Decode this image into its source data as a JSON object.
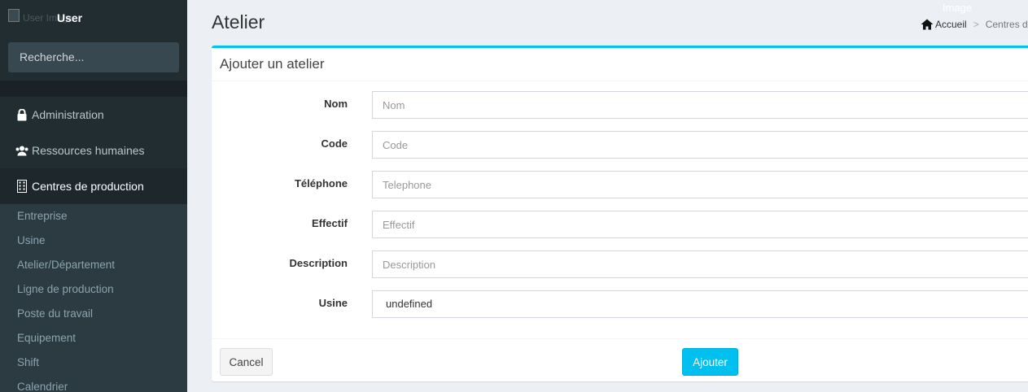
{
  "sidebar": {
    "user_img_alt": "User Image",
    "user_name": "User",
    "search_placeholder": "Recherche...",
    "menu": [
      {
        "label": "Administration",
        "icon": "lock-icon"
      },
      {
        "label": "Ressources humaines",
        "icon": "users-icon"
      },
      {
        "label": "Centres de production",
        "icon": "building-icon"
      }
    ],
    "submenu": [
      "Entreprise",
      "Usine",
      "Atelier/Département",
      "Ligne de production",
      "Poste du travail",
      "Equipement",
      "Shift",
      "Calendrier"
    ]
  },
  "header": {
    "title": "Atelier",
    "image_label": "Image",
    "breadcrumb": {
      "home": "Accueil",
      "current": "Centres de p"
    }
  },
  "form": {
    "title": "Ajouter un atelier",
    "fields": [
      {
        "label": "Nom",
        "placeholder": "Nom"
      },
      {
        "label": "Code",
        "placeholder": "Code"
      },
      {
        "label": "Téléphone",
        "placeholder": "Telephone"
      },
      {
        "label": "Effectif",
        "placeholder": "Effectif"
      },
      {
        "label": "Description",
        "placeholder": "Description"
      }
    ],
    "usine_label": "Usine",
    "usine_value": "undefined",
    "cancel_label": "Cancel",
    "submit_label": "Ajouter"
  },
  "colors": {
    "accent": "#00c0ef",
    "sidebar": "#222d32"
  }
}
